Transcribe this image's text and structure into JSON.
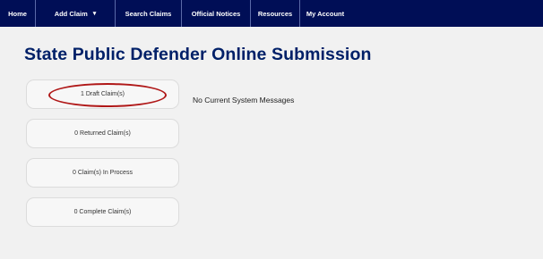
{
  "navbar": {
    "items": [
      {
        "label": "Home"
      },
      {
        "label": "Add Claim"
      },
      {
        "label": "Search Claims"
      },
      {
        "label": "Official Notices"
      },
      {
        "label": "Resources"
      },
      {
        "label": "My Account"
      }
    ],
    "add_claim_caret": "▾"
  },
  "page": {
    "title": "State Public Defender Online Submission"
  },
  "claims": {
    "buttons": [
      {
        "label": "1 Draft Claim(s)"
      },
      {
        "label": "0 Returned Claim(s)"
      },
      {
        "label": "0 Claim(s) In Process"
      },
      {
        "label": "0 Complete Claim(s)"
      }
    ]
  },
  "messages": {
    "system": "No Current System Messages"
  },
  "colors": {
    "navbar_bg": "#000e56",
    "title": "#002068",
    "annotation": "#b01818",
    "page_bg": "#f1f1f1"
  }
}
